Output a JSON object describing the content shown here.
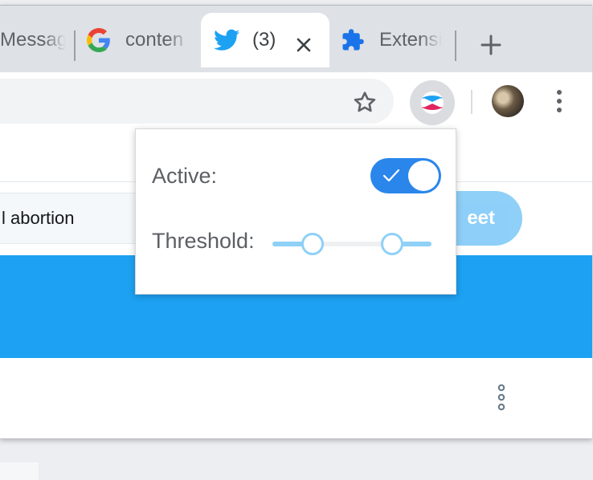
{
  "browser": {
    "tabs": [
      {
        "label": "Messag",
        "icon": "message-icon"
      },
      {
        "label": "conten",
        "icon": "google-g-icon"
      },
      {
        "label": "(3)",
        "icon": "twitter-bird-icon",
        "active": true
      },
      {
        "label": "Extensi",
        "icon": "puzzle-piece-icon"
      }
    ],
    "new_tab_icon": "plus-icon",
    "close_icon": "close-icon"
  },
  "toolbar": {
    "bookmark_icon": "star-icon",
    "extension_icon": "extension-logo-icon",
    "menu_icon": "vertical-dots-icon"
  },
  "page": {
    "search_text": "l abortion",
    "tweet_button_label": "eet",
    "more_icon": "more-vertical-icon"
  },
  "popup": {
    "active_label": "Active:",
    "active_value": true,
    "threshold_label": "Threshold:",
    "threshold_range": [
      0.25,
      0.75
    ]
  },
  "colors": {
    "twitter_blue": "#1da1f2",
    "toggle_blue": "#2a86ea",
    "slider_light_blue": "#8fd0f6",
    "tabstrip": "#dee1e6"
  }
}
